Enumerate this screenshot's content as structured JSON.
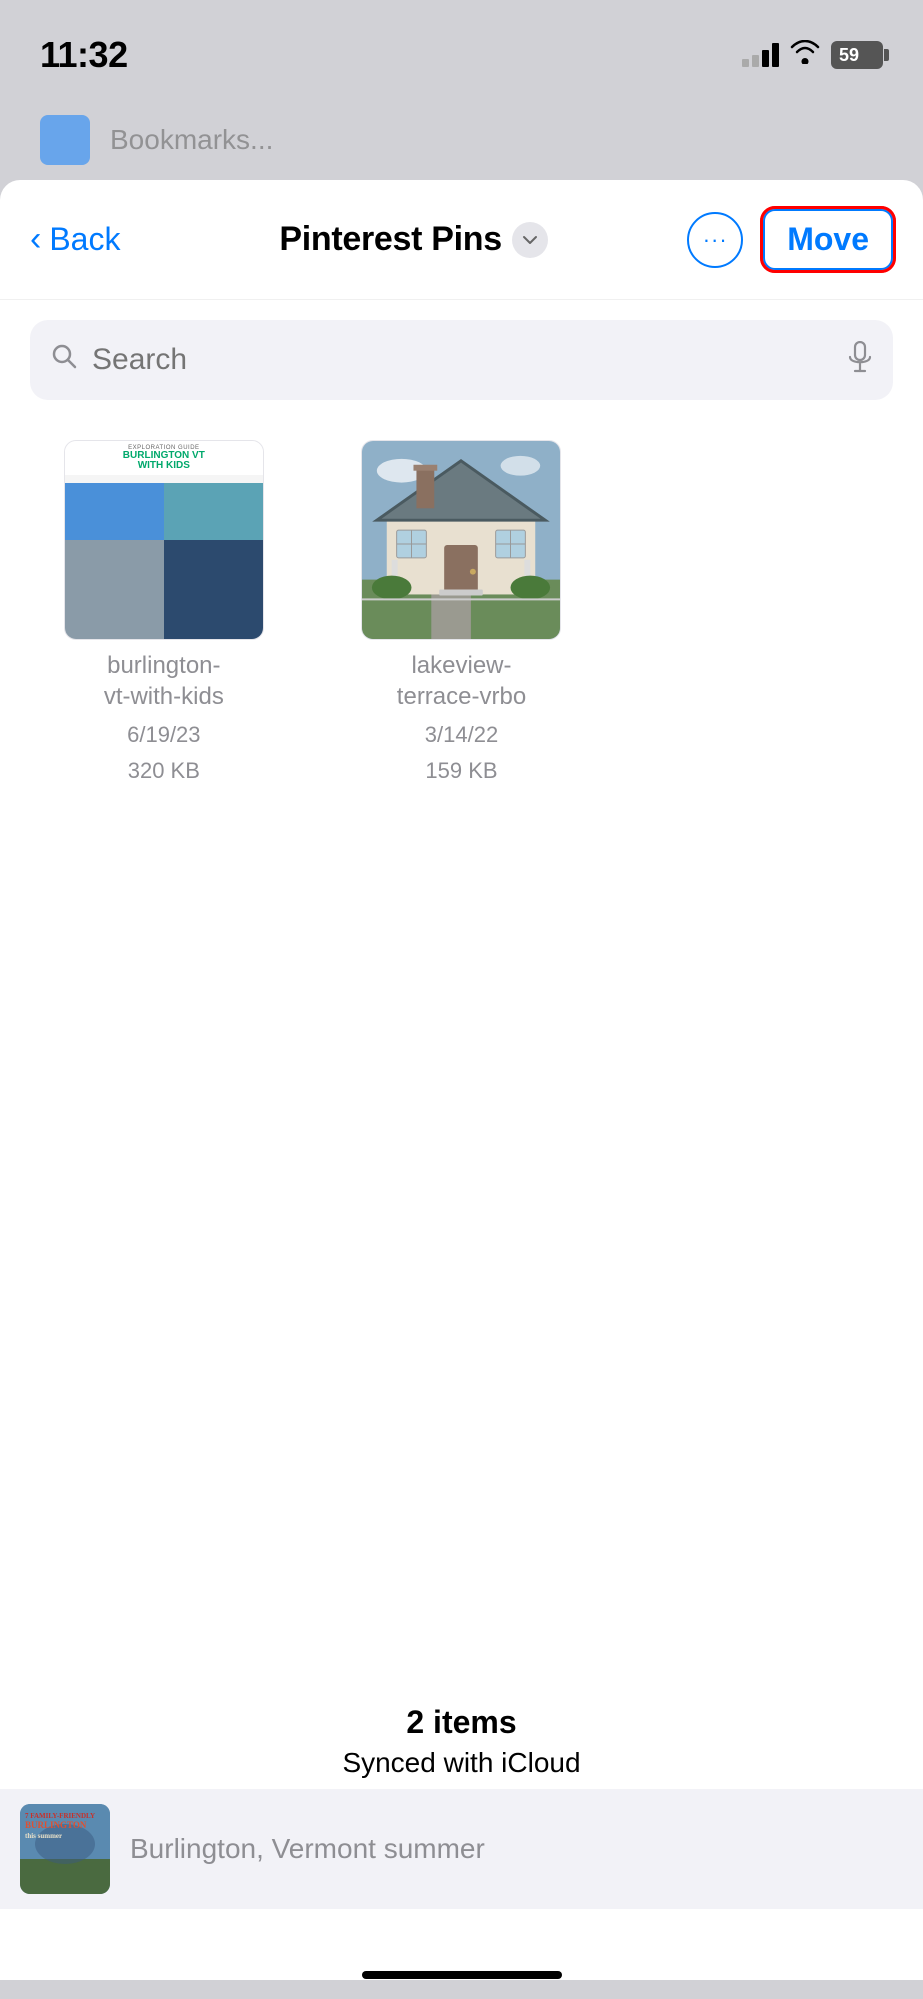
{
  "status_bar": {
    "time": "11:32",
    "signal_strength": 2,
    "wifi": true,
    "battery": "59"
  },
  "nav": {
    "back_label": "Back",
    "title": "Pinterest Pins",
    "more_label": "···",
    "move_label": "Move"
  },
  "search": {
    "placeholder": "Search"
  },
  "files": [
    {
      "name": "burlington-\nvt-with-kids",
      "date": "6/19/23",
      "size": "320 KB",
      "type": "burlington"
    },
    {
      "name": "lakeview-\nterrace-vrbo",
      "date": "3/14/22",
      "size": "159 KB",
      "type": "lakeview"
    }
  ],
  "footer": {
    "items_count": "2 items",
    "sync_status": "Synced with iCloud"
  },
  "suggestion": {
    "text": "Burlington, Vermont summer"
  }
}
